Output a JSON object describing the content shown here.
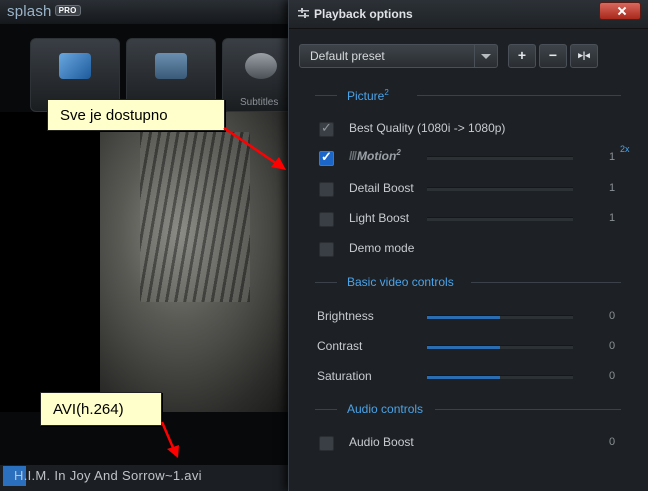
{
  "player": {
    "logo_text": "splash",
    "logo_badge": "PRO",
    "toolbar_label": "Subtitles",
    "filename": "H.I.M. In Joy And Sorrow~1.avi",
    "accent_color": "#2b6fbf"
  },
  "annotations": {
    "callout_1": "Sve je dostupno",
    "callout_2": "AVI(h.264)",
    "arrow_color": "#ff0000"
  },
  "panel": {
    "title": "Playback options",
    "preset": {
      "value": "Default preset"
    },
    "preset_buttons": [
      {
        "icon": "add-preset-icon",
        "symbol": "+"
      },
      {
        "icon": "remove-preset-icon",
        "symbol": "−"
      },
      {
        "icon": "split-preset-icon",
        "symbol": "▸|◂"
      }
    ],
    "sections": {
      "picture": {
        "label": "Picture",
        "sup": "2"
      },
      "basic": {
        "label": "Basic video controls"
      },
      "audio": {
        "label": "Audio controls"
      }
    },
    "picture_rows": [
      {
        "label": "Best Quality (1080i -> 1080p)",
        "checked": true,
        "style": "dim"
      },
      {
        "label": "Motion",
        "sup": "2",
        "checked": true,
        "style": "blue",
        "value": "1",
        "value_sup": "2x",
        "level": 0.0
      },
      {
        "label": "Detail Boost",
        "checked": false,
        "value": "1",
        "level": 0.0
      },
      {
        "label": "Light Boost",
        "checked": false,
        "value": "1",
        "level": 0.0
      },
      {
        "label": "Demo mode",
        "checked": false
      }
    ],
    "basic_rows": [
      {
        "label": "Brightness",
        "value": "0",
        "level": 0.5
      },
      {
        "label": "Contrast",
        "value": "0",
        "level": 0.5
      },
      {
        "label": "Saturation",
        "value": "0",
        "level": 0.5
      }
    ],
    "audio_rows": [
      {
        "label": "Audio Boost",
        "checked": false,
        "value": "0"
      }
    ],
    "accent_color": "#4ba3e8"
  }
}
